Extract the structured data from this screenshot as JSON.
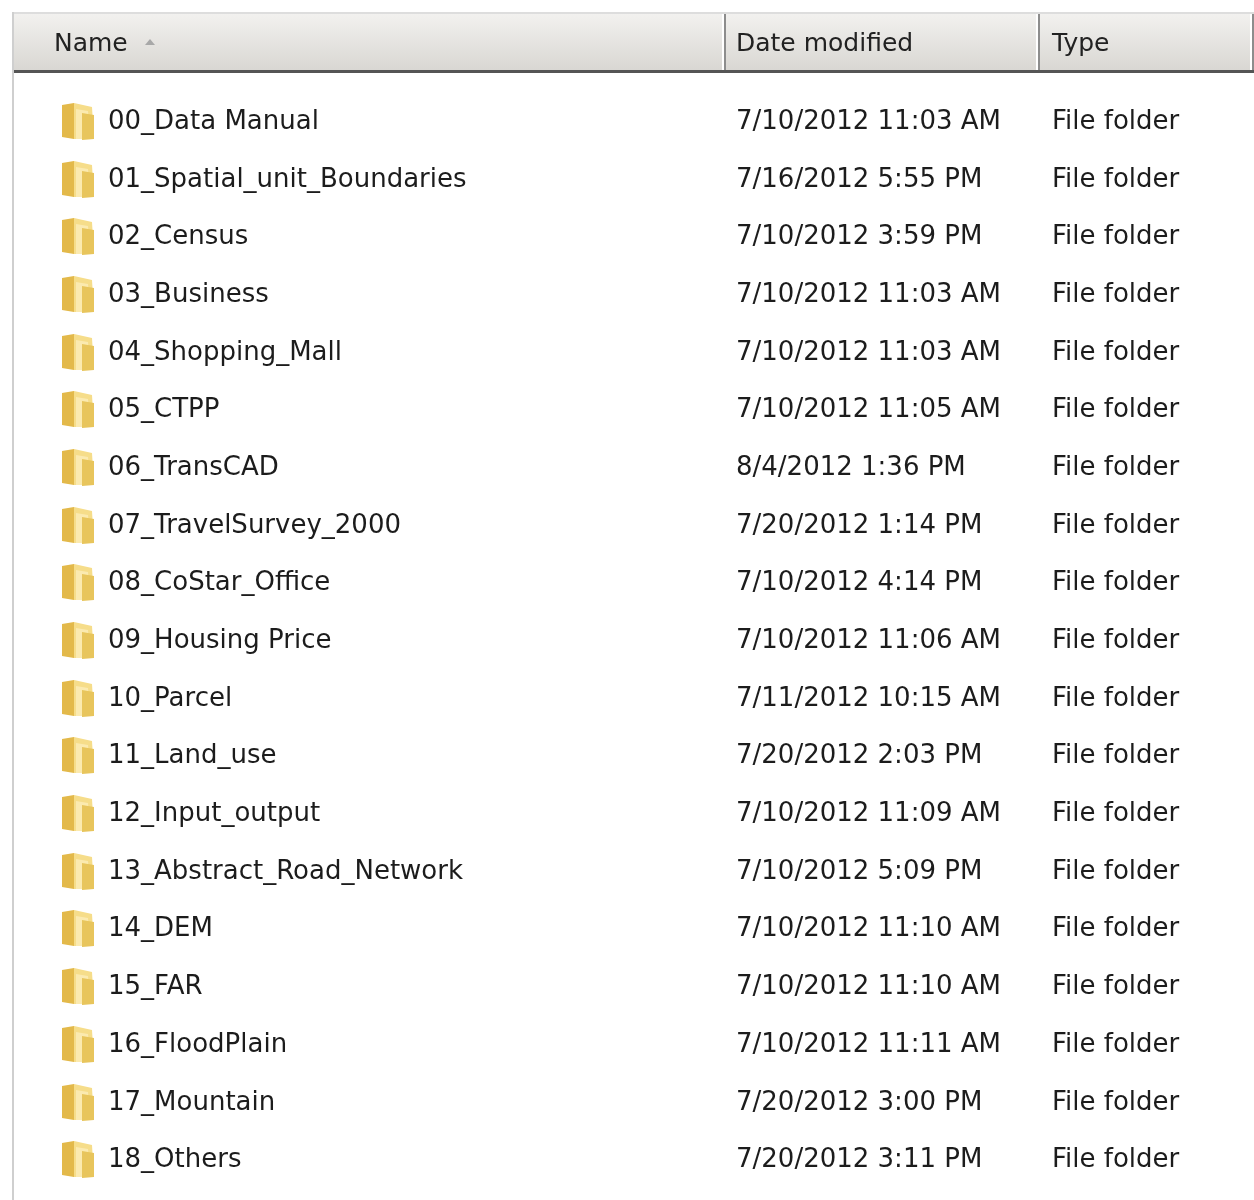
{
  "columns": [
    {
      "label": "Name",
      "sorted": true
    },
    {
      "label": "Date modified",
      "sorted": false
    },
    {
      "label": "Type",
      "sorted": false
    }
  ],
  "rows": [
    {
      "name": "00_Data Manual",
      "date": "7/10/2012 11:03 AM",
      "type": "File folder"
    },
    {
      "name": "01_Spatial_unit_Boundaries",
      "date": "7/16/2012 5:55 PM",
      "type": "File folder"
    },
    {
      "name": "02_Census",
      "date": "7/10/2012 3:59 PM",
      "type": "File folder"
    },
    {
      "name": "03_Business",
      "date": "7/10/2012 11:03 AM",
      "type": "File folder"
    },
    {
      "name": "04_Shopping_Mall",
      "date": "7/10/2012 11:03 AM",
      "type": "File folder"
    },
    {
      "name": "05_CTPP",
      "date": "7/10/2012 11:05 AM",
      "type": "File folder"
    },
    {
      "name": "06_TransCAD",
      "date": "8/4/2012 1:36 PM",
      "type": "File folder"
    },
    {
      "name": "07_TravelSurvey_2000",
      "date": "7/20/2012 1:14 PM",
      "type": "File folder"
    },
    {
      "name": "08_CoStar_Office",
      "date": "7/10/2012 4:14 PM",
      "type": "File folder"
    },
    {
      "name": "09_Housing Price",
      "date": "7/10/2012 11:06 AM",
      "type": "File folder"
    },
    {
      "name": "10_Parcel",
      "date": "7/11/2012 10:15 AM",
      "type": "File folder"
    },
    {
      "name": "11_Land_use",
      "date": "7/20/2012 2:03 PM",
      "type": "File folder"
    },
    {
      "name": "12_Input_output",
      "date": "7/10/2012 11:09 AM",
      "type": "File folder"
    },
    {
      "name": "13_Abstract_Road_Network",
      "date": "7/10/2012 5:09 PM",
      "type": "File folder"
    },
    {
      "name": "14_DEM",
      "date": "7/10/2012 11:10 AM",
      "type": "File folder"
    },
    {
      "name": "15_FAR",
      "date": "7/10/2012 11:10 AM",
      "type": "File folder"
    },
    {
      "name": "16_FloodPlain",
      "date": "7/10/2012 11:11 AM",
      "type": "File folder"
    },
    {
      "name": "17_Mountain",
      "date": "7/20/2012 3:00 PM",
      "type": "File folder"
    },
    {
      "name": "18_Others",
      "date": "7/20/2012 3:11 PM",
      "type": "File folder"
    }
  ]
}
